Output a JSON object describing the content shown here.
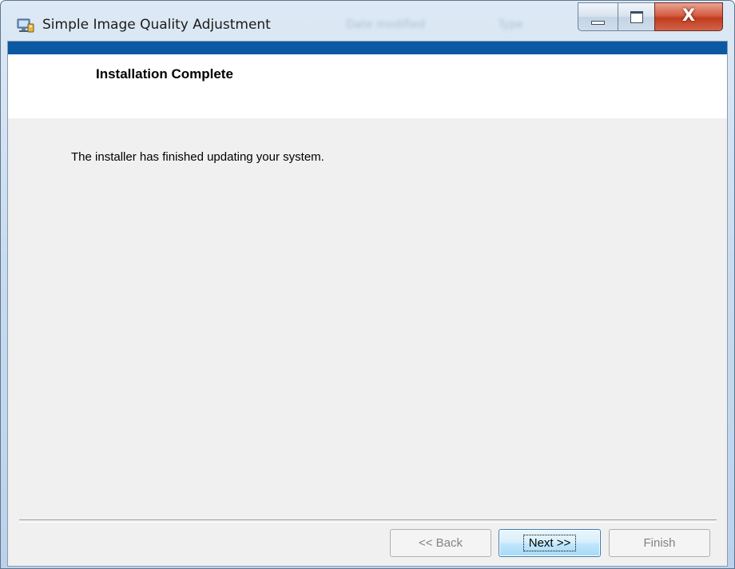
{
  "window": {
    "title": "Simple Image Quality Adjustment",
    "background_hints": [
      "Date modified",
      "Type"
    ]
  },
  "colors": {
    "accent_bar": "#0b58a3",
    "content_bg": "#f0f0f0",
    "header_bg": "#ffffff",
    "close_button": "#c13b1e"
  },
  "icons": {
    "app": "installer-computer-icon",
    "minimize": "minimize-icon",
    "maximize": "maximize-icon",
    "close": "close-icon"
  },
  "header": {
    "title": "Installation Complete"
  },
  "body": {
    "message": "The installer has finished updating your system."
  },
  "buttons": {
    "back": {
      "label": "<< Back",
      "enabled": false
    },
    "next": {
      "label": "Next >>",
      "enabled": true,
      "default": true
    },
    "finish": {
      "label": "Finish",
      "enabled": false
    }
  }
}
